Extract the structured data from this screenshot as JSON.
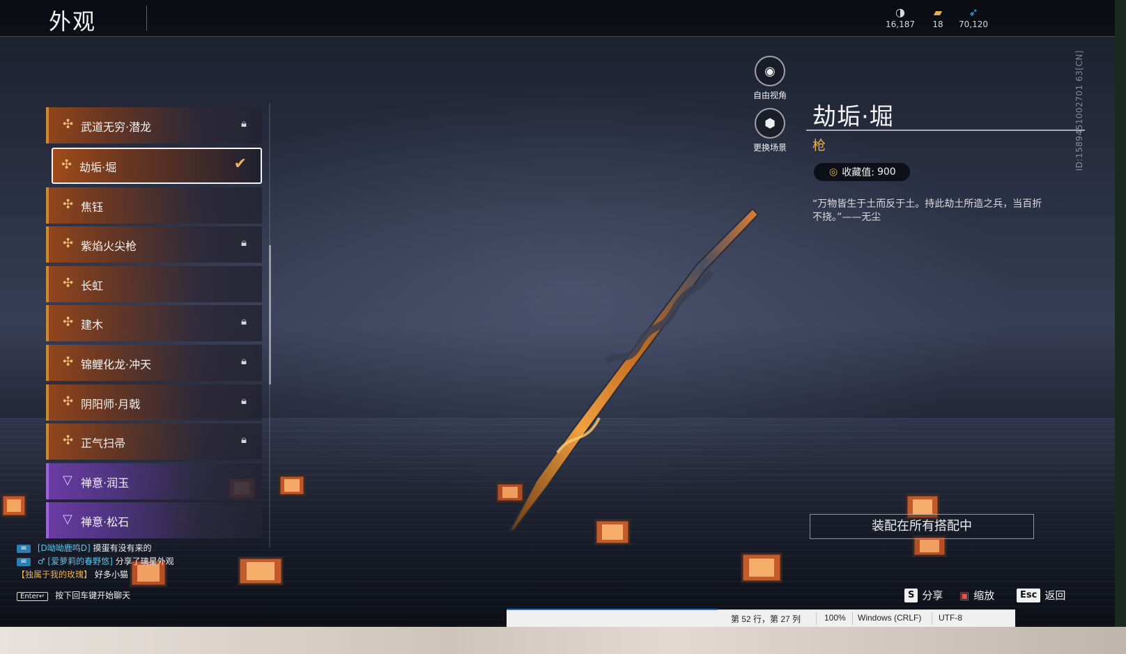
{
  "header": {
    "title": "外观",
    "currencies": [
      {
        "icon": "moon-coin-icon",
        "value": "16,187"
      },
      {
        "icon": "ticket-icon",
        "value": "18"
      },
      {
        "icon": "feather-icon",
        "value": "70,120"
      }
    ]
  },
  "list": {
    "items": [
      {
        "label": "武道无穷·潜龙",
        "rarity": "gold",
        "locked": true,
        "selected": false
      },
      {
        "label": "劫垢·堀",
        "rarity": "gold",
        "locked": false,
        "selected": true
      },
      {
        "label": "焦钰",
        "rarity": "gold",
        "locked": false,
        "selected": false
      },
      {
        "label": "紫焰火尖枪",
        "rarity": "gold",
        "locked": true,
        "selected": false
      },
      {
        "label": "长虹",
        "rarity": "gold",
        "locked": false,
        "selected": false
      },
      {
        "label": "建木",
        "rarity": "gold",
        "locked": true,
        "selected": false
      },
      {
        "label": "锦鲤化龙·冲天",
        "rarity": "gold",
        "locked": true,
        "selected": false
      },
      {
        "label": "阴阳师·月戟",
        "rarity": "gold",
        "locked": true,
        "selected": false
      },
      {
        "label": "正气扫帚",
        "rarity": "gold",
        "locked": true,
        "selected": false
      },
      {
        "label": "禅意·润玉",
        "rarity": "purple",
        "locked": false,
        "selected": false
      },
      {
        "label": "禅意·松石",
        "rarity": "purple",
        "locked": false,
        "selected": false
      }
    ]
  },
  "side_buttons": {
    "free_view": "自由视角",
    "change_scene": "更换场景"
  },
  "detail": {
    "name": "劫垢·堀",
    "type": "枪",
    "collect_label": "收藏值:",
    "collect_value": "900",
    "quote": "“万物皆生于土而反于土。持此劫土所造之兵，当百折不挠。”——无尘",
    "equip_all": "装配在所有搭配中"
  },
  "player_id": "ID:1589451002701 63[CN]",
  "chat": {
    "messages": [
      {
        "name": "[D呦呦鹿鸣D]",
        "text": "摸蛋有没有来的"
      },
      {
        "name": "[爱萝莉的春野悠]",
        "text": "分享了璃星外观"
      },
      {
        "name": "【独属于我的玫瑰】",
        "text": "好多小猫"
      }
    ],
    "enter_key": "Enter↵",
    "input_hint": "按下回车键开始聊天"
  },
  "hints": {
    "share_key": "S",
    "share": "分享",
    "zoom": "缩放",
    "back_key": "Esc",
    "back": "返回"
  },
  "statusbar": {
    "position": "第 52 行，第 27 列",
    "zoom": "100%",
    "eol": "Windows (CRLF)",
    "encoding": "UTF-8"
  },
  "colors": {
    "gold_accent": "#c98a32",
    "purple_accent": "#9b64d8",
    "type_color": "#e8b04a"
  }
}
